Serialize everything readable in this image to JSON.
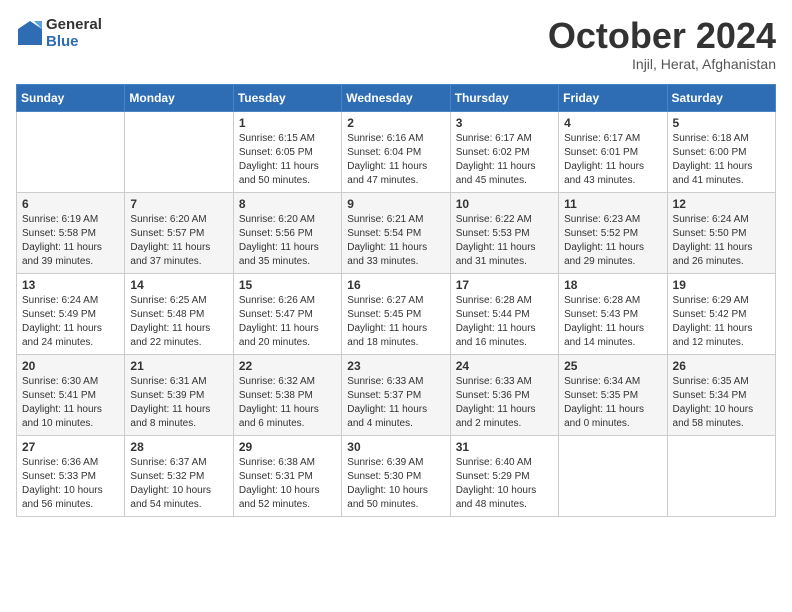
{
  "header": {
    "logo_line1": "General",
    "logo_line2": "Blue",
    "month_title": "October 2024",
    "location": "Injil, Herat, Afghanistan"
  },
  "days_of_week": [
    "Sunday",
    "Monday",
    "Tuesday",
    "Wednesday",
    "Thursday",
    "Friday",
    "Saturday"
  ],
  "weeks": [
    [
      {
        "num": "",
        "info": ""
      },
      {
        "num": "",
        "info": ""
      },
      {
        "num": "1",
        "info": "Sunrise: 6:15 AM\nSunset: 6:05 PM\nDaylight: 11 hours and 50 minutes."
      },
      {
        "num": "2",
        "info": "Sunrise: 6:16 AM\nSunset: 6:04 PM\nDaylight: 11 hours and 47 minutes."
      },
      {
        "num": "3",
        "info": "Sunrise: 6:17 AM\nSunset: 6:02 PM\nDaylight: 11 hours and 45 minutes."
      },
      {
        "num": "4",
        "info": "Sunrise: 6:17 AM\nSunset: 6:01 PM\nDaylight: 11 hours and 43 minutes."
      },
      {
        "num": "5",
        "info": "Sunrise: 6:18 AM\nSunset: 6:00 PM\nDaylight: 11 hours and 41 minutes."
      }
    ],
    [
      {
        "num": "6",
        "info": "Sunrise: 6:19 AM\nSunset: 5:58 PM\nDaylight: 11 hours and 39 minutes."
      },
      {
        "num": "7",
        "info": "Sunrise: 6:20 AM\nSunset: 5:57 PM\nDaylight: 11 hours and 37 minutes."
      },
      {
        "num": "8",
        "info": "Sunrise: 6:20 AM\nSunset: 5:56 PM\nDaylight: 11 hours and 35 minutes."
      },
      {
        "num": "9",
        "info": "Sunrise: 6:21 AM\nSunset: 5:54 PM\nDaylight: 11 hours and 33 minutes."
      },
      {
        "num": "10",
        "info": "Sunrise: 6:22 AM\nSunset: 5:53 PM\nDaylight: 11 hours and 31 minutes."
      },
      {
        "num": "11",
        "info": "Sunrise: 6:23 AM\nSunset: 5:52 PM\nDaylight: 11 hours and 29 minutes."
      },
      {
        "num": "12",
        "info": "Sunrise: 6:24 AM\nSunset: 5:50 PM\nDaylight: 11 hours and 26 minutes."
      }
    ],
    [
      {
        "num": "13",
        "info": "Sunrise: 6:24 AM\nSunset: 5:49 PM\nDaylight: 11 hours and 24 minutes."
      },
      {
        "num": "14",
        "info": "Sunrise: 6:25 AM\nSunset: 5:48 PM\nDaylight: 11 hours and 22 minutes."
      },
      {
        "num": "15",
        "info": "Sunrise: 6:26 AM\nSunset: 5:47 PM\nDaylight: 11 hours and 20 minutes."
      },
      {
        "num": "16",
        "info": "Sunrise: 6:27 AM\nSunset: 5:45 PM\nDaylight: 11 hours and 18 minutes."
      },
      {
        "num": "17",
        "info": "Sunrise: 6:28 AM\nSunset: 5:44 PM\nDaylight: 11 hours and 16 minutes."
      },
      {
        "num": "18",
        "info": "Sunrise: 6:28 AM\nSunset: 5:43 PM\nDaylight: 11 hours and 14 minutes."
      },
      {
        "num": "19",
        "info": "Sunrise: 6:29 AM\nSunset: 5:42 PM\nDaylight: 11 hours and 12 minutes."
      }
    ],
    [
      {
        "num": "20",
        "info": "Sunrise: 6:30 AM\nSunset: 5:41 PM\nDaylight: 11 hours and 10 minutes."
      },
      {
        "num": "21",
        "info": "Sunrise: 6:31 AM\nSunset: 5:39 PM\nDaylight: 11 hours and 8 minutes."
      },
      {
        "num": "22",
        "info": "Sunrise: 6:32 AM\nSunset: 5:38 PM\nDaylight: 11 hours and 6 minutes."
      },
      {
        "num": "23",
        "info": "Sunrise: 6:33 AM\nSunset: 5:37 PM\nDaylight: 11 hours and 4 minutes."
      },
      {
        "num": "24",
        "info": "Sunrise: 6:33 AM\nSunset: 5:36 PM\nDaylight: 11 hours and 2 minutes."
      },
      {
        "num": "25",
        "info": "Sunrise: 6:34 AM\nSunset: 5:35 PM\nDaylight: 11 hours and 0 minutes."
      },
      {
        "num": "26",
        "info": "Sunrise: 6:35 AM\nSunset: 5:34 PM\nDaylight: 10 hours and 58 minutes."
      }
    ],
    [
      {
        "num": "27",
        "info": "Sunrise: 6:36 AM\nSunset: 5:33 PM\nDaylight: 10 hours and 56 minutes."
      },
      {
        "num": "28",
        "info": "Sunrise: 6:37 AM\nSunset: 5:32 PM\nDaylight: 10 hours and 54 minutes."
      },
      {
        "num": "29",
        "info": "Sunrise: 6:38 AM\nSunset: 5:31 PM\nDaylight: 10 hours and 52 minutes."
      },
      {
        "num": "30",
        "info": "Sunrise: 6:39 AM\nSunset: 5:30 PM\nDaylight: 10 hours and 50 minutes."
      },
      {
        "num": "31",
        "info": "Sunrise: 6:40 AM\nSunset: 5:29 PM\nDaylight: 10 hours and 48 minutes."
      },
      {
        "num": "",
        "info": ""
      },
      {
        "num": "",
        "info": ""
      }
    ]
  ]
}
